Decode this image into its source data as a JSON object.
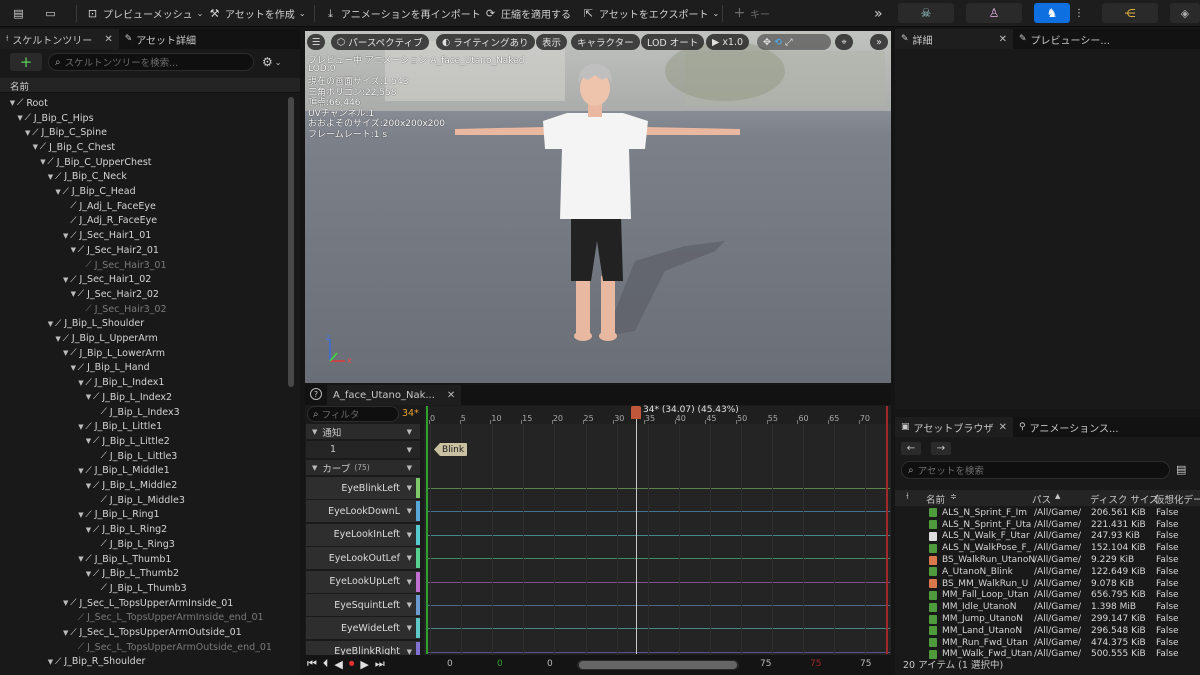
{
  "toolbar": {
    "preview_mesh": "プレビューメッシュ",
    "create_asset": "アセットを作成",
    "reimport": "アニメーションを再インポート",
    "apply_compression": "圧縮を適用する",
    "export_asset": "アセットをエクスポート",
    "key": "キー"
  },
  "left_panel": {
    "tab_skeleton_tree": "スケルトンツリー",
    "tab_asset_details": "アセット詳細",
    "search_placeholder": "スケルトンツリーを検索...",
    "header_name": "名前",
    "bones": [
      {
        "label": "Root",
        "depth": 0,
        "dim": false,
        "expand": true
      },
      {
        "label": "J_Bip_C_Hips",
        "depth": 1,
        "dim": false,
        "expand": true
      },
      {
        "label": "J_Bip_C_Spine",
        "depth": 2,
        "dim": false,
        "expand": true
      },
      {
        "label": "J_Bip_C_Chest",
        "depth": 3,
        "dim": false,
        "expand": true
      },
      {
        "label": "J_Bip_C_UpperChest",
        "depth": 4,
        "dim": false,
        "expand": true
      },
      {
        "label": "J_Bip_C_Neck",
        "depth": 5,
        "dim": false,
        "expand": true
      },
      {
        "label": "J_Bip_C_Head",
        "depth": 6,
        "dim": false,
        "expand": true
      },
      {
        "label": "J_Adj_L_FaceEye",
        "depth": 7,
        "dim": false,
        "expand": false
      },
      {
        "label": "J_Adj_R_FaceEye",
        "depth": 7,
        "dim": false,
        "expand": false
      },
      {
        "label": "J_Sec_Hair1_01",
        "depth": 7,
        "dim": false,
        "expand": true
      },
      {
        "label": "J_Sec_Hair2_01",
        "depth": 8,
        "dim": false,
        "expand": true
      },
      {
        "label": "J_Sec_Hair3_01",
        "depth": 9,
        "dim": true,
        "expand": false
      },
      {
        "label": "J_Sec_Hair1_02",
        "depth": 7,
        "dim": false,
        "expand": true
      },
      {
        "label": "J_Sec_Hair2_02",
        "depth": 8,
        "dim": false,
        "expand": true
      },
      {
        "label": "J_Sec_Hair3_02",
        "depth": 9,
        "dim": true,
        "expand": false
      },
      {
        "label": "J_Bip_L_Shoulder",
        "depth": 5,
        "dim": false,
        "expand": true
      },
      {
        "label": "J_Bip_L_UpperArm",
        "depth": 6,
        "dim": false,
        "expand": true
      },
      {
        "label": "J_Bip_L_LowerArm",
        "depth": 7,
        "dim": false,
        "expand": true
      },
      {
        "label": "J_Bip_L_Hand",
        "depth": 8,
        "dim": false,
        "expand": true
      },
      {
        "label": "J_Bip_L_Index1",
        "depth": 9,
        "dim": false,
        "expand": true
      },
      {
        "label": "J_Bip_L_Index2",
        "depth": 10,
        "dim": false,
        "expand": true
      },
      {
        "label": "J_Bip_L_Index3",
        "depth": 11,
        "dim": false,
        "expand": false
      },
      {
        "label": "J_Bip_L_Little1",
        "depth": 9,
        "dim": false,
        "expand": true
      },
      {
        "label": "J_Bip_L_Little2",
        "depth": 10,
        "dim": false,
        "expand": true
      },
      {
        "label": "J_Bip_L_Little3",
        "depth": 11,
        "dim": false,
        "expand": false
      },
      {
        "label": "J_Bip_L_Middle1",
        "depth": 9,
        "dim": false,
        "expand": true
      },
      {
        "label": "J_Bip_L_Middle2",
        "depth": 10,
        "dim": false,
        "expand": true
      },
      {
        "label": "J_Bip_L_Middle3",
        "depth": 11,
        "dim": false,
        "expand": false
      },
      {
        "label": "J_Bip_L_Ring1",
        "depth": 9,
        "dim": false,
        "expand": true
      },
      {
        "label": "J_Bip_L_Ring2",
        "depth": 10,
        "dim": false,
        "expand": true
      },
      {
        "label": "J_Bip_L_Ring3",
        "depth": 11,
        "dim": false,
        "expand": false
      },
      {
        "label": "J_Bip_L_Thumb1",
        "depth": 9,
        "dim": false,
        "expand": true
      },
      {
        "label": "J_Bip_L_Thumb2",
        "depth": 10,
        "dim": false,
        "expand": true
      },
      {
        "label": "J_Bip_L_Thumb3",
        "depth": 11,
        "dim": false,
        "expand": false
      },
      {
        "label": "J_Sec_L_TopsUpperArmInside_01",
        "depth": 7,
        "dim": false,
        "expand": true
      },
      {
        "label": "J_Sec_L_TopsUpperArmInside_end_01",
        "depth": 8,
        "dim": true,
        "expand": false
      },
      {
        "label": "J_Sec_L_TopsUpperArmOutside_01",
        "depth": 7,
        "dim": false,
        "expand": true
      },
      {
        "label": "J_Sec_L_TopsUpperArmOutside_end_01",
        "depth": 8,
        "dim": true,
        "expand": false
      },
      {
        "label": "J_Bip_R_Shoulder",
        "depth": 5,
        "dim": false,
        "expand": true
      }
    ]
  },
  "viewport": {
    "btn_perspective": "パースペクティブ",
    "btn_lighting": "ライティングあり",
    "btn_show": "表示",
    "btn_character": "キャラクター",
    "btn_lod": "LOD オート",
    "btn_speed": "x1.0",
    "stats": [
      "プレビュー中 アニメーション A_face_Utano_Naked",
      "LOD:0",
      "現在の画面サイズ:1.543",
      "三角ポリゴン:22,558",
      "頂点:66,446",
      "UVチャンネル:1",
      "おおよそのサイズ:200x200x200",
      "フレームレート:1 s"
    ]
  },
  "timeline": {
    "tab_label": "A_face_Utano_Nak...",
    "filter_placeholder": "フィルタ",
    "frame_badge": "34*",
    "playhead_label": "34* (34.07) (45.43%)",
    "notify_label": "通知",
    "notify_track": "1",
    "blink_label": "Blink",
    "curves_label": "カーブ",
    "curves_count": "(75)",
    "ruler": [
      "0",
      "5",
      "10",
      "15",
      "20",
      "25",
      "30",
      "35",
      "40",
      "45",
      "50",
      "55",
      "60",
      "65",
      "70"
    ],
    "curves": [
      {
        "name": "EyeBlinkLeft",
        "color": "#7ec86a"
      },
      {
        "name": "EyeLookDownL",
        "color": "#5aa8d8"
      },
      {
        "name": "EyeLookInLeft",
        "color": "#58c8d0"
      },
      {
        "name": "EyeLookOutLef",
        "color": "#58d090"
      },
      {
        "name": "EyeLookUpLeft",
        "color": "#c070d0"
      },
      {
        "name": "EyeSquintLeft",
        "color": "#6a9ad0"
      },
      {
        "name": "EyeWideLeft",
        "color": "#60c8c8"
      },
      {
        "name": "EyeBlinkRight",
        "color": "#8070d0"
      }
    ],
    "bottom": {
      "start": "0",
      "green": "0",
      "mid": "0",
      "end1": "75",
      "red": "75",
      "end2": "75"
    }
  },
  "right_panel": {
    "tab_details": "詳細",
    "tab_preview": "プレビューシー..."
  },
  "asset_browser": {
    "tab_asset_browser": "アセットブラウザ",
    "tab_anim_seq": "アニメーションス...",
    "search_placeholder": "アセットを検索",
    "col_name": "名前",
    "col_path": "パス",
    "col_size": "ディスク サイズ",
    "col_virtual": "仮想化デー",
    "rows": [
      {
        "name": "ALS_N_Sprint_F_Im",
        "path": "/All/Game/",
        "size": "206.561 KiB",
        "virtual": "False",
        "icon": "green"
      },
      {
        "name": "ALS_N_Sprint_F_Uta",
        "path": "/All/Game/",
        "size": "221.431 KiB",
        "virtual": "False",
        "icon": "green"
      },
      {
        "name": "ALS_N_Walk_F_Utar",
        "path": "/All/Game/",
        "size": "247.93 KiB",
        "virtual": "False",
        "icon": "white"
      },
      {
        "name": "ALS_N_WalkPose_F_",
        "path": "/All/Game/",
        "size": "152.104 KiB",
        "virtual": "False",
        "icon": "green"
      },
      {
        "name": "BS_WalkRun_UtanoN",
        "path": "/All/Game/",
        "size": "9.229 KiB",
        "virtual": "False",
        "icon": "orange"
      },
      {
        "name": "A_UtanoN_Blink",
        "path": "/All/Game/",
        "size": "122.649 KiB",
        "virtual": "False",
        "icon": "green"
      },
      {
        "name": "BS_MM_WalkRun_U",
        "path": "/All/Game/",
        "size": "9.078 KiB",
        "virtual": "False",
        "icon": "orange"
      },
      {
        "name": "MM_Fall_Loop_Utan",
        "path": "/All/Game/",
        "size": "656.795 KiB",
        "virtual": "False",
        "icon": "green"
      },
      {
        "name": "MM_Idle_UtanoN",
        "path": "/All/Game/",
        "size": "1.398 MiB",
        "virtual": "False",
        "icon": "green"
      },
      {
        "name": "MM_Jump_UtanoN",
        "path": "/All/Game/",
        "size": "299.147 KiB",
        "virtual": "False",
        "icon": "green"
      },
      {
        "name": "MM_Land_UtanoN",
        "path": "/All/Game/",
        "size": "296.548 KiB",
        "virtual": "False",
        "icon": "green"
      },
      {
        "name": "MM_Run_Fwd_Utan",
        "path": "/All/Game/",
        "size": "474.375 KiB",
        "virtual": "False",
        "icon": "green"
      },
      {
        "name": "MM_Walk_Fwd_Utan",
        "path": "/All/Game/",
        "size": "500.555 KiB",
        "virtual": "False",
        "icon": "green"
      }
    ],
    "status": "20 アイテム (1 選択中)"
  }
}
